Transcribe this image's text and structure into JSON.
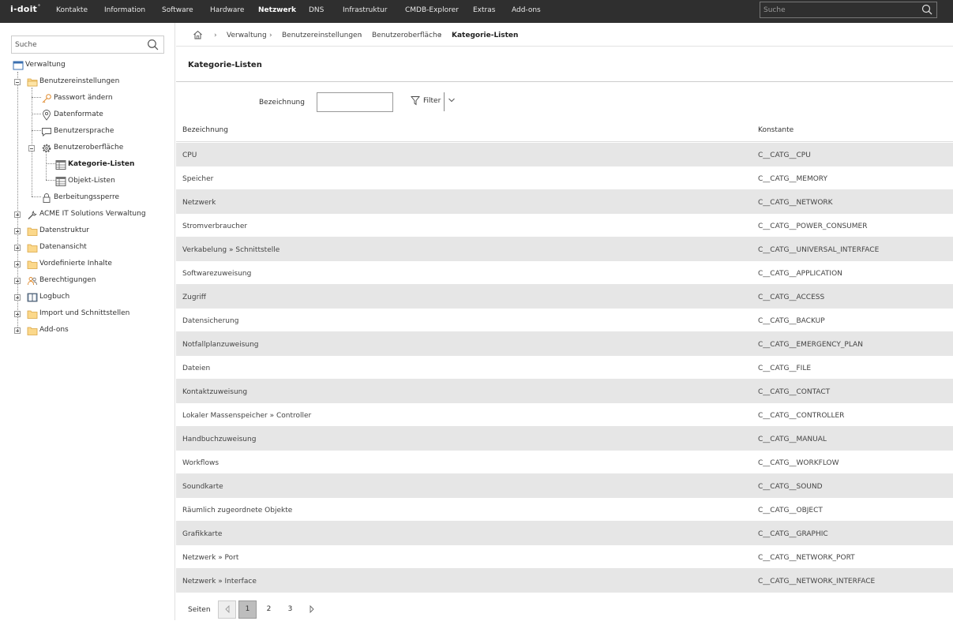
{
  "app": {
    "logo": "i-doit",
    "logo_sup": "°"
  },
  "topnav": {
    "items": [
      {
        "label": "Kontakte"
      },
      {
        "label": "Information"
      },
      {
        "label": "Software"
      },
      {
        "label": "Hardware"
      },
      {
        "label": "Netzwerk",
        "active": true
      },
      {
        "label": "DNS"
      },
      {
        "label": "Infrastruktur"
      },
      {
        "label": "CMDB-Explorer"
      },
      {
        "label": "Extras"
      },
      {
        "label": "Add-ons"
      }
    ],
    "search_placeholder": "Suche"
  },
  "sidebar": {
    "search_placeholder": "Suche",
    "tree": [
      {
        "label": "Verwaltung",
        "icon": "window-icon"
      },
      {
        "label": "Benutzereinstellungen",
        "icon": "folder-open-icon"
      },
      {
        "label": "Passwort ändern",
        "icon": "key-icon"
      },
      {
        "label": "Datenformate",
        "icon": "location-pin-icon"
      },
      {
        "label": "Benutzersprache",
        "icon": "speech-bubble-icon"
      },
      {
        "label": "Benutzeroberfläche",
        "icon": "gear-icon"
      },
      {
        "label": "Kategorie-Listen",
        "icon": "table-icon",
        "selected": true
      },
      {
        "label": "Objekt-Listen",
        "icon": "table-icon"
      },
      {
        "label": "Berbeitungssperre",
        "icon": "lock-icon"
      },
      {
        "label": "ACME IT Solutions Verwaltung",
        "icon": "wrench-icon"
      },
      {
        "label": "Datenstruktur",
        "icon": "folder-icon"
      },
      {
        "label": "Datenansicht",
        "icon": "folder-icon"
      },
      {
        "label": "Vordefinierte Inhalte",
        "icon": "folder-icon"
      },
      {
        "label": "Berechtigungen",
        "icon": "users-icon"
      },
      {
        "label": "Logbuch",
        "icon": "book-icon"
      },
      {
        "label": "Import und Schnittstellen",
        "icon": "folder-icon"
      },
      {
        "label": "Add-ons",
        "icon": "folder-icon"
      }
    ]
  },
  "breadcrumb": {
    "items": [
      "Verwaltung",
      "Benutzereinstellungen",
      "Benutzeroberfläche",
      "Kategorie-Listen"
    ]
  },
  "page": {
    "title": "Kategorie-Listen",
    "filter_label": "Bezeichnung",
    "filter_value": "",
    "filter_button": "Filter"
  },
  "table": {
    "columns": [
      "Bezeichnung",
      "Konstante"
    ],
    "rows": [
      [
        "CPU",
        "C__CATG__CPU"
      ],
      [
        "Speicher",
        "C__CATG__MEMORY"
      ],
      [
        "Netzwerk",
        "C__CATG__NETWORK"
      ],
      [
        "Stromverbraucher",
        "C__CATG__POWER_CONSUMER"
      ],
      [
        "Verkabelung » Schnittstelle",
        "C__CATG__UNIVERSAL_INTERFACE"
      ],
      [
        "Softwarezuweisung",
        "C__CATG__APPLICATION"
      ],
      [
        "Zugriff",
        "C__CATG__ACCESS"
      ],
      [
        "Datensicherung",
        "C__CATG__BACKUP"
      ],
      [
        "Notfallplanzuweisung",
        "C__CATG__EMERGENCY_PLAN"
      ],
      [
        "Dateien",
        "C__CATG__FILE"
      ],
      [
        "Kontaktzuweisung",
        "C__CATG__CONTACT"
      ],
      [
        "Lokaler Massenspeicher » Controller",
        "C__CATG__CONTROLLER"
      ],
      [
        "Handbuchzuweisung",
        "C__CATG__MANUAL"
      ],
      [
        "Workflows",
        "C__CATG__WORKFLOW"
      ],
      [
        "Soundkarte",
        "C__CATG__SOUND"
      ],
      [
        "Räumlich zugeordnete Objekte",
        "C__CATG__OBJECT"
      ],
      [
        "Grafikkarte",
        "C__CATG__GRAPHIC"
      ],
      [
        "Netzwerk » Port",
        "C__CATG__NETWORK_PORT"
      ],
      [
        "Netzwerk » Interface",
        "C__CATG__NETWORK_INTERFACE"
      ]
    ]
  },
  "pager": {
    "label": "Seiten",
    "pages": [
      "1",
      "2",
      "3"
    ],
    "current": "1"
  }
}
